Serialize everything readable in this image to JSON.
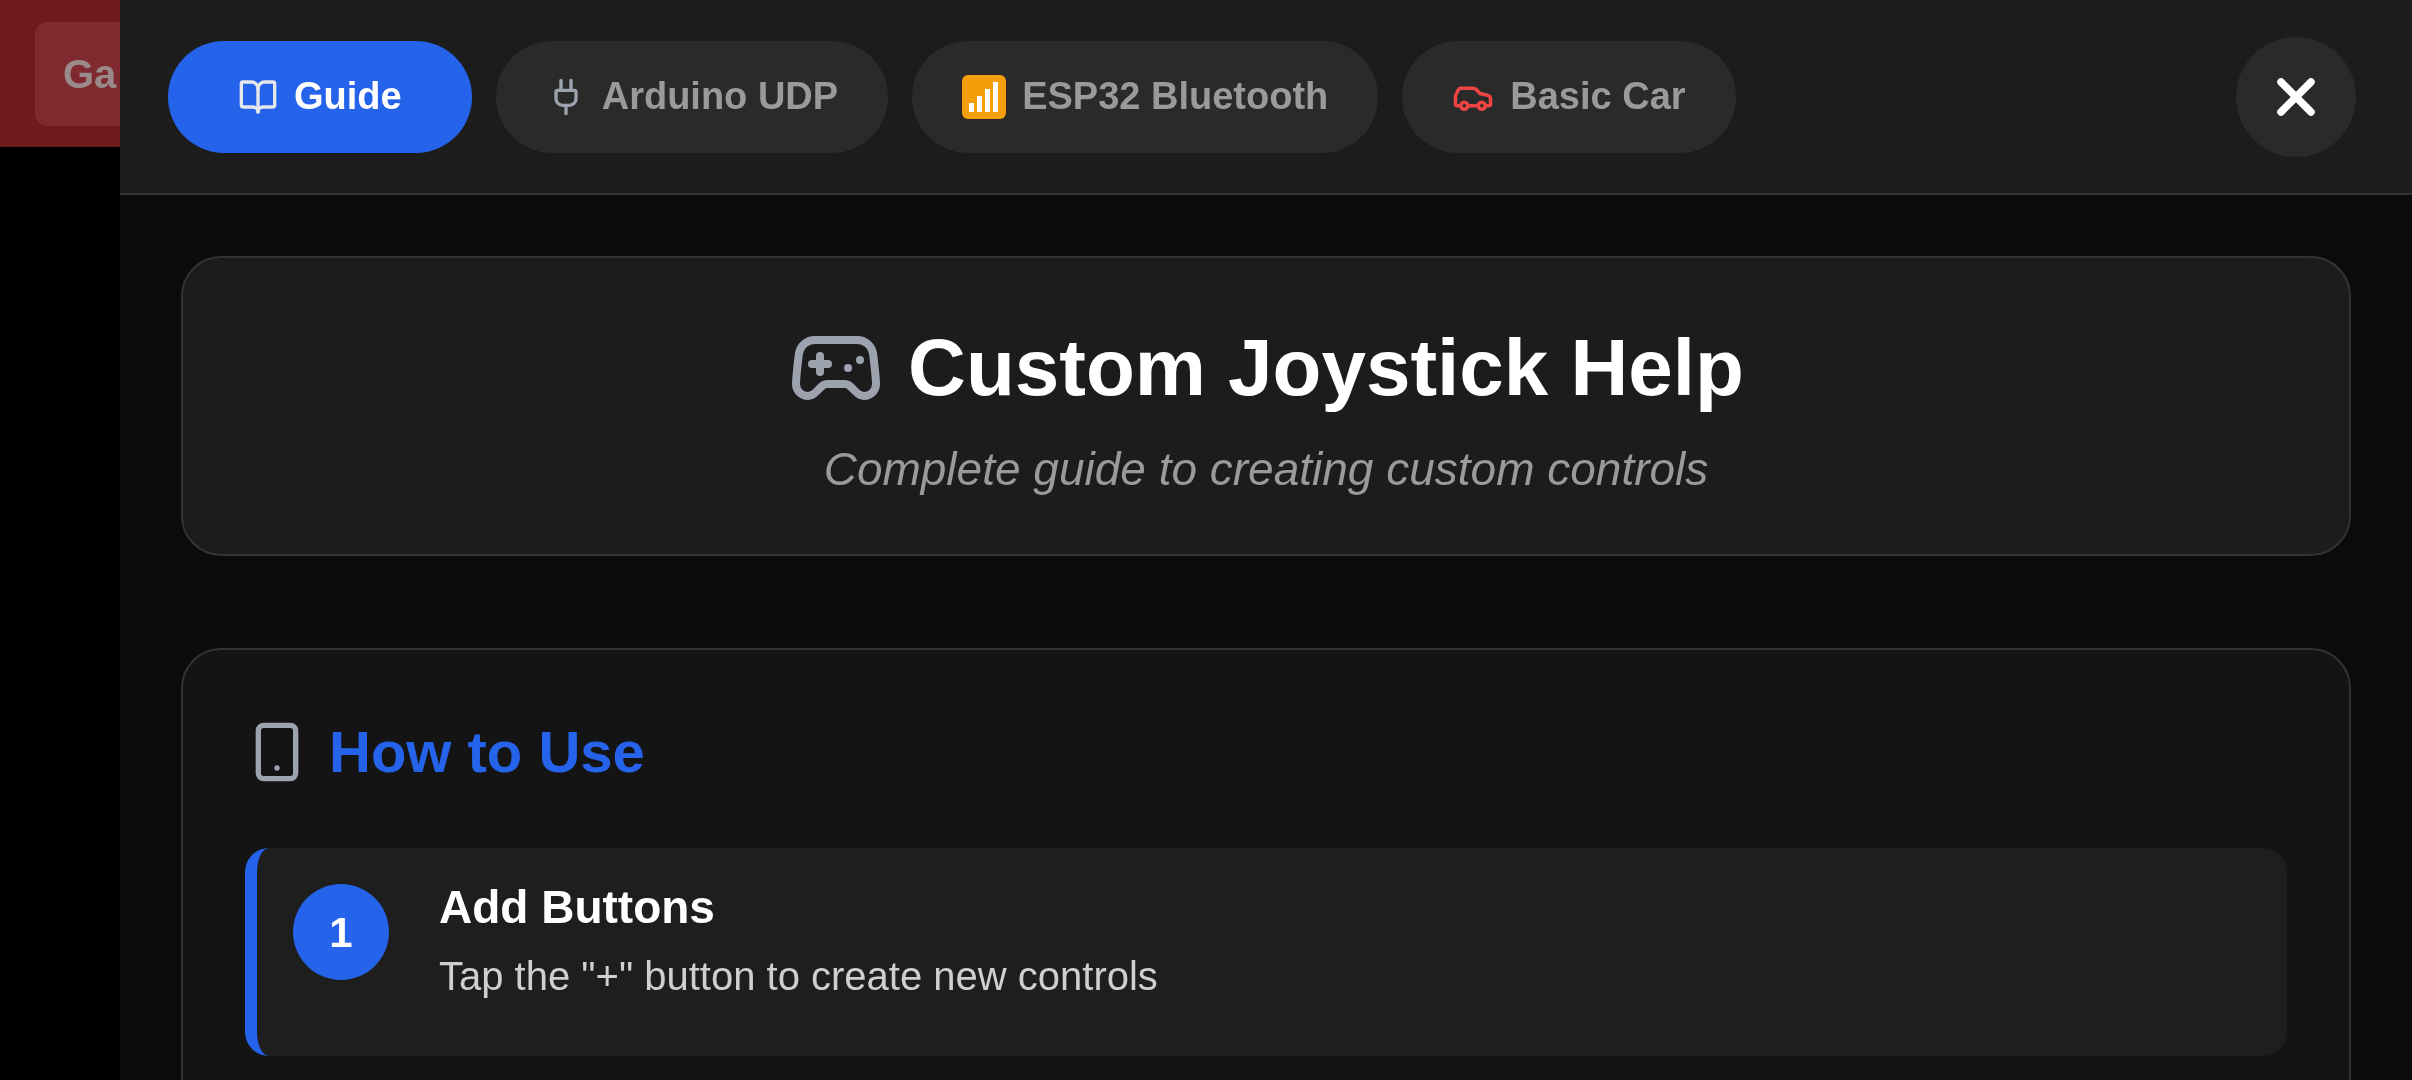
{
  "background": {
    "button": "Ga"
  },
  "tabs": [
    {
      "label": "Guide",
      "selected": true
    },
    {
      "label": "Arduino UDP",
      "selected": false
    },
    {
      "label": "ESP32 Bluetooth",
      "selected": false
    },
    {
      "label": "Basic Car",
      "selected": false
    }
  ],
  "header": {
    "title": "Custom Joystick Help",
    "subtitle": "Complete guide to creating custom controls"
  },
  "section": {
    "title": "How to Use",
    "steps": [
      {
        "number": "1",
        "title": "Add Buttons",
        "text": "Tap the \"+\" button to create new controls"
      }
    ]
  }
}
